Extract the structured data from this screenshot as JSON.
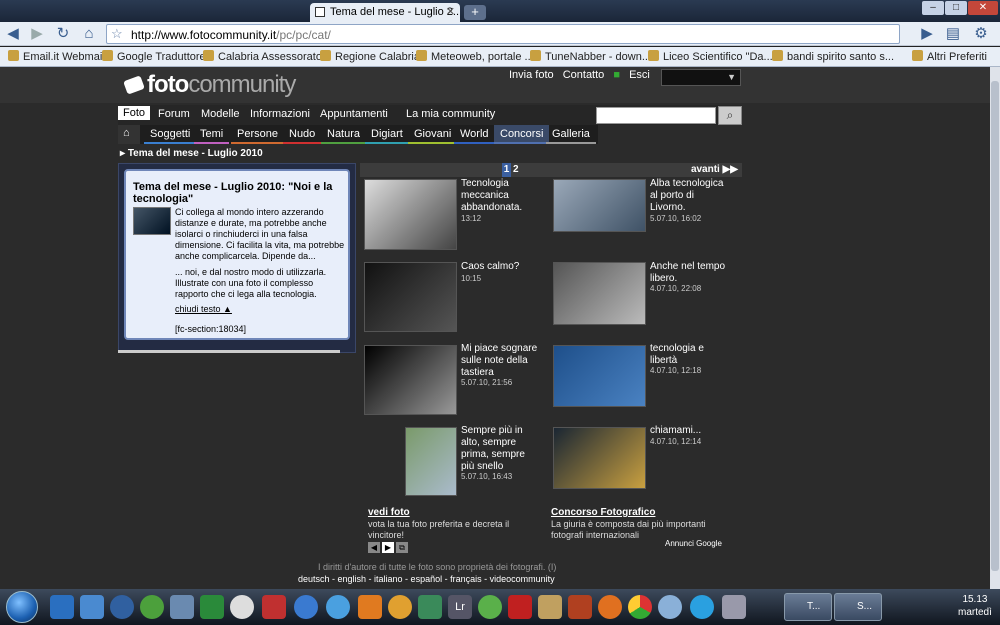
{
  "browser": {
    "tab_title": "Tema del mese - Luglio 2...",
    "new_tab": "+",
    "url_domain": "http://www.fotocommunity.it",
    "url_path": "/pc/pc/cat/",
    "window_controls": [
      "–",
      "□",
      "✕"
    ]
  },
  "bookmarks": [
    {
      "label": "Email.it Webmail"
    },
    {
      "label": "Google Traduttore"
    },
    {
      "label": "Calabria Assessorato..."
    },
    {
      "label": "Regione Calabria"
    },
    {
      "label": "Meteoweb, portale ..."
    },
    {
      "label": "TuneNabber - down..."
    },
    {
      "label": "Liceo Scientifico \"Da..."
    },
    {
      "label": "bandi spirito santo s..."
    },
    {
      "label": "Altri Preferiti"
    }
  ],
  "site": {
    "logo_part1": "foto",
    "logo_part2": "community",
    "top_links": {
      "invia": "Invia foto",
      "contatto": "Contatto",
      "esci": "Esci"
    },
    "main_nav": [
      "Foto",
      "Forum",
      "Modelle",
      "Informazioni",
      "Appuntamenti",
      "La mia community"
    ],
    "search_button": "⌕",
    "sub_nav": [
      "Soggetti",
      "Temi",
      "Persone",
      "Nudo",
      "Natura",
      "Digiart",
      "Giovani",
      "World",
      "Concorsi",
      "Galleria"
    ],
    "breadcrumb": "Tema del mese - Luglio 2010"
  },
  "theme_box": {
    "title": "Tema del mese - Luglio 2010: \"Noi e la tecnologia\"",
    "desc1": "Ci collega al mondo intero azzerando distanze e durate, ma potrebbe anche isolarci o rinchiuderci in una falsa dimensione. Ci facilita la vita, ma potrebbe anche complicarcela. Dipende da...",
    "desc2": "... noi, e dal nostro modo di utilizzarla. Illustrate con una foto il complesso rapporto che ci lega alla tecnologia.",
    "close": "chiudi testo ▲",
    "section": "[fc-section:18034]"
  },
  "pager": {
    "p1": "1",
    "p2": "2",
    "next": "avanti ▶▶"
  },
  "photos": [
    {
      "title": "Tecnologia meccanica abbandonata.",
      "date": "13:12",
      "colors": [
        "#ddd",
        "#444"
      ]
    },
    {
      "title": "Alba tecnologica al porto di Livorno.",
      "date": "5.07.10, 16:02",
      "colors": [
        "#9aa8b8",
        "#3f5266"
      ]
    },
    {
      "title": "Caos calmo?",
      "date": "10:15",
      "colors": [
        "#111",
        "#555"
      ]
    },
    {
      "title": "Anche nel tempo libero.",
      "date": "4.07.10, 22:08",
      "colors": [
        "#555",
        "#bbb"
      ]
    },
    {
      "title": "Mi piace sognare sulle note della tastiera",
      "date": "5.07.10, 21:56",
      "colors": [
        "#000",
        "#999"
      ]
    },
    {
      "title": "tecnologia e libertà",
      "date": "4.07.10, 12:18",
      "colors": [
        "#1e4f8a",
        "#4a82c2"
      ]
    },
    {
      "title": "Sempre più in alto, sempre prima, sempre più snello",
      "date": "5.07.10, 16:43",
      "colors": [
        "#7a9a6a",
        "#aabbcc"
      ]
    },
    {
      "title": "chiamami...",
      "date": "4.07.10, 12:14",
      "colors": [
        "#1a2633",
        "#c9a040"
      ]
    }
  ],
  "ads": {
    "vedi_title": "vedi foto",
    "vedi_desc": "vota la tua foto preferita e decreta il vincitore!",
    "concorso_title": "Concorso Fotografico",
    "concorso_desc": "La giuria è composta dai più importanti fotografi internazionali",
    "google": "Annunci Google",
    "controls": [
      "◀",
      "▶",
      "⧉"
    ]
  },
  "footer": {
    "copyright": "I diritti d'autore di tutte le foto sono proprietà dei fotografi. (I)",
    "langs": "deutsch - english - italiano - español - français - videocommunity"
  },
  "taskbar": {
    "tasks": [
      "T...",
      "S..."
    ],
    "time": "15.13",
    "day": "martedì"
  }
}
